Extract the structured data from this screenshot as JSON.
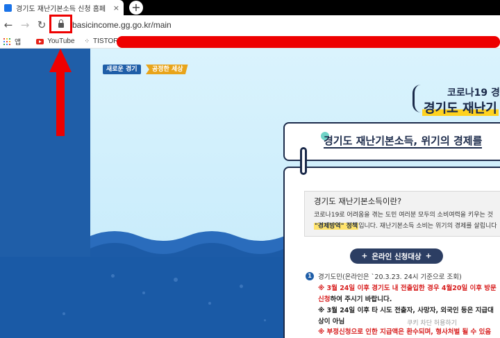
{
  "browser": {
    "tab_title": "경기도 재난기본소득 신청 홈페",
    "tab_close": "×",
    "new_tab": "+",
    "back": "←",
    "forward": "→",
    "reload": "↻",
    "url": "basicincome.gg.go.kr/main",
    "bookmarks": [
      {
        "label": "앱",
        "icon": "apps-grid-icon"
      },
      {
        "label": "YouTube",
        "icon": "youtube-icon"
      },
      {
        "label": "TISTORY",
        "icon": "tistory-icon"
      }
    ],
    "redaction_color": "#ee0000"
  },
  "page": {
    "tags": [
      "새로운 경기",
      "공정한 세상"
    ],
    "hero": {
      "line1": "코로나19 경",
      "line2": "경기도 재난기"
    },
    "title": "경기도 재난기본소득, 위기의 경제를",
    "info": {
      "title": "경기도 재난기본소득이란?",
      "line1": "코로나19로 어려움을 겪는 도민 여러분 모두의 소비여력을 키우는 것",
      "line2_highlight": "\"경제방역\" 정책",
      "line2_rest": "입니다. 재난기본소득 소비는 위기의 경제를 살립니다"
    },
    "pill": {
      "label": "온라인 신청대상",
      "left": "+",
      "right": "+"
    },
    "item": {
      "number": "1",
      "line1": "경기도민(온라인은 `20.3.23. 24시 기준으로 조회)",
      "line2_red": "※ 3월 24일 이후 경기도 내 전출입한 경우 4월20일 이후 방문",
      "line3_a": "신청",
      "line3_b": "하여 주시기 바랍니다.",
      "line4": "※ 3월 24일 이후 타 시도 전출자, 사망자, 외국인 등은 지급대",
      "line5": "상이 아님",
      "line6": "※ 부정신청으로 인한 지급액은 환수되며, 형사처벌 될 수 있음"
    },
    "popup_hint": "쿠키 차단 허용하기"
  },
  "colors": {
    "navy": "#1b2a4a",
    "brand_blue": "#1f5ea8",
    "accent_yellow": "#ffd21f",
    "annotation_red": "#ee0000"
  }
}
